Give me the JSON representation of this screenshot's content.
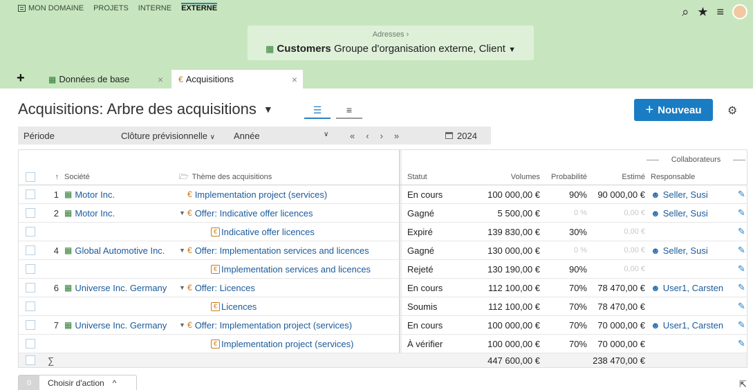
{
  "nav": {
    "items": [
      "MON DOMAINE",
      "PROJETS",
      "INTERNE",
      "EXTERNE"
    ],
    "active": 3
  },
  "context": {
    "breadcrumb": "Adresses  ›",
    "title": "Customers",
    "subtitle": "Groupe d'organisation externe, Client"
  },
  "tabs": [
    {
      "label": "Données de base"
    },
    {
      "label": "Acquisitions"
    }
  ],
  "page": {
    "title": "Acquisitions: Arbre des acquisitions",
    "new_label": "Nouveau"
  },
  "filters": {
    "period_label": "Période",
    "closing": "Clôture prévisionnelle",
    "granularity": "Année",
    "year": "2024"
  },
  "table": {
    "group_header": "Collaborateurs",
    "columns": {
      "societe": "Société",
      "theme": "Thème des acquisitions",
      "statut": "Statut",
      "volumes": "Volumes",
      "probabilite": "Probabilité",
      "estime": "Estimé",
      "responsable": "Responsable"
    },
    "rows": [
      {
        "num": "1",
        "societe": "Motor Inc.",
        "theme": "Implementation project (services)",
        "kind": "project",
        "expand": false,
        "child": false,
        "statut": "En cours",
        "volumes": "100 000,00 €",
        "prob": "90%",
        "estime": "90 000,00 €",
        "resp": "Seller, Susi",
        "faint": false
      },
      {
        "num": "2",
        "societe": "Motor Inc.",
        "theme": "Offer: Indicative offer licences",
        "kind": "project",
        "expand": true,
        "child": false,
        "statut": "Gagné",
        "volumes": "5 500,00 €",
        "prob": "0 %",
        "estime": "0,00 €",
        "resp": "Seller, Susi",
        "faint": true
      },
      {
        "num": "",
        "societe": "",
        "theme": "Indicative offer licences",
        "kind": "item",
        "expand": false,
        "child": true,
        "statut": "Expiré",
        "volumes": "139 830,00 €",
        "prob": "30%",
        "estime": "0,00 €",
        "resp": "",
        "faint": false,
        "faintEst": true
      },
      {
        "num": "4",
        "societe": "Global Automotive Inc.",
        "theme": "Offer: Implementation services and licences",
        "kind": "project",
        "expand": true,
        "child": false,
        "statut": "Gagné",
        "volumes": "130 000,00 €",
        "prob": "0 %",
        "estime": "0,00 €",
        "resp": "Seller, Susi",
        "faint": true
      },
      {
        "num": "",
        "societe": "",
        "theme": "Implementation services and licences",
        "kind": "item",
        "expand": false,
        "child": true,
        "statut": "Rejeté",
        "volumes": "130 190,00 €",
        "prob": "90%",
        "estime": "0,00 €",
        "resp": "",
        "faint": false,
        "faintEst": true
      },
      {
        "num": "6",
        "societe": "Universe Inc. Germany",
        "theme": "Offer: Licences",
        "kind": "project",
        "expand": true,
        "child": false,
        "statut": "En cours",
        "volumes": "112 100,00 €",
        "prob": "70%",
        "estime": "78 470,00 €",
        "resp": "User1, Carsten",
        "faint": false
      },
      {
        "num": "",
        "societe": "",
        "theme": "Licences",
        "kind": "item",
        "expand": false,
        "child": true,
        "statut": "Soumis",
        "volumes": "112 100,00 €",
        "prob": "70%",
        "estime": "78 470,00 €",
        "resp": "",
        "faint": false
      },
      {
        "num": "7",
        "societe": "Universe Inc. Germany",
        "theme": "Offer: Implementation project (services)",
        "kind": "project",
        "expand": true,
        "child": false,
        "statut": "En cours",
        "volumes": "100 000,00 €",
        "prob": "70%",
        "estime": "70 000,00 €",
        "resp": "User1, Carsten",
        "faint": false
      },
      {
        "num": "",
        "societe": "",
        "theme": "Implementation project (services)",
        "kind": "item",
        "expand": false,
        "child": true,
        "statut": "À vérifier",
        "volumes": "100 000,00 €",
        "prob": "70%",
        "estime": "70 000,00 €",
        "resp": "",
        "faint": false
      }
    ],
    "totals": {
      "symbol": "∑",
      "volumes": "447 600,00 €",
      "estime": "238 470,00 €"
    }
  },
  "actionbar": {
    "count": "0",
    "label": "Choisir d'action"
  }
}
